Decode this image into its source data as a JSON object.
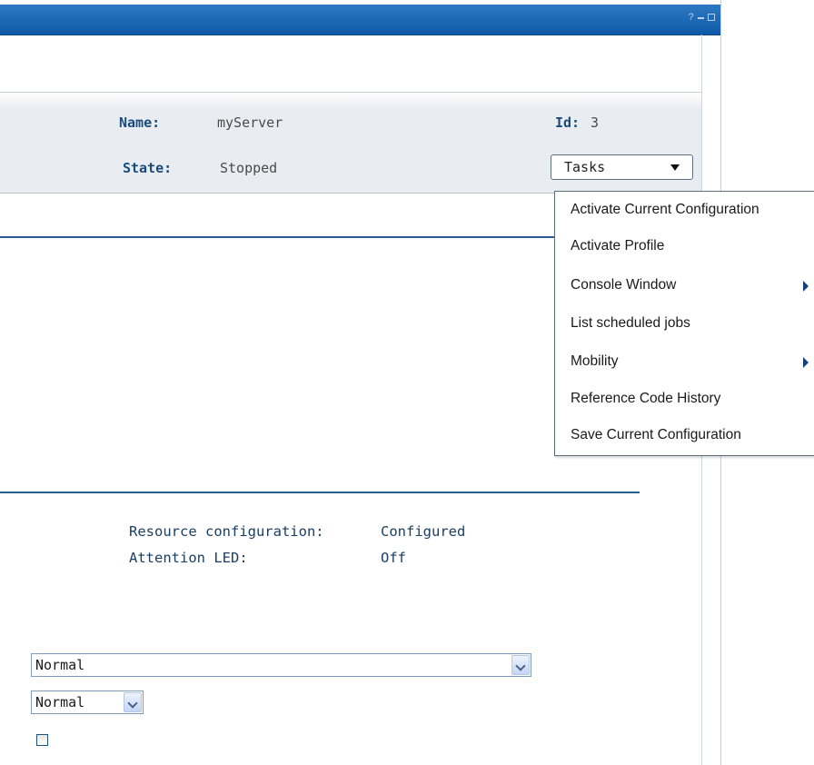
{
  "window": {
    "controls": {
      "help": "?"
    }
  },
  "properties": {
    "name_label": "Name:",
    "name_value": "myServer",
    "id_label": "Id:",
    "id_value": "3",
    "state_label": "State:",
    "state_value": "Stopped"
  },
  "tasks_button": {
    "label": "Tasks"
  },
  "tasks_menu": {
    "items": [
      {
        "label": "Activate Current Configuration",
        "submenu": false
      },
      {
        "label": "Activate Profile",
        "submenu": false
      },
      {
        "label": "Console Window",
        "submenu": true
      },
      {
        "label": "List scheduled jobs",
        "submenu": false
      },
      {
        "label": "Mobility",
        "submenu": true
      },
      {
        "label": "Reference Code History",
        "submenu": false
      },
      {
        "label": "Save Current Configuration",
        "submenu": false
      }
    ]
  },
  "info": {
    "resource_configuration_label": "Resource configuration:",
    "resource_configuration_value": "Configured",
    "attention_led_label": "Attention LED:",
    "attention_led_value": "Off"
  },
  "selects": {
    "wide_select_value": "Normal",
    "small_select_value": "Normal"
  },
  "checkbox": {
    "checked": false
  },
  "colors": {
    "titlebar": "#1a66b4",
    "label_text": "#1a4b7a",
    "divider": "#2a5d8f"
  }
}
